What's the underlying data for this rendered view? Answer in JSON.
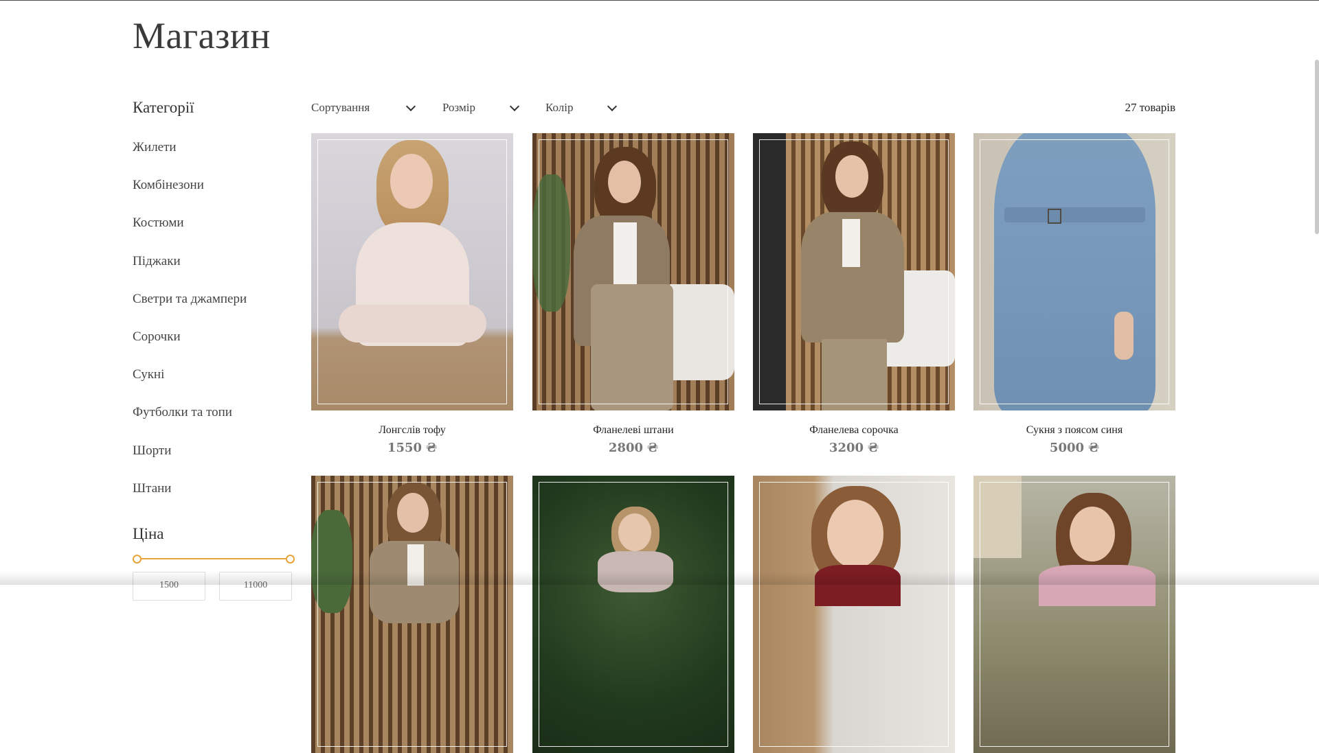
{
  "shop": {
    "title": "Магазин"
  },
  "sidebar": {
    "categories_heading": "Категорії",
    "categories": [
      "Жилети",
      "Комбінезони",
      "Костюми",
      "Піджаки",
      "Светри та джампери",
      "Сорочки",
      "Сукні",
      "Футболки та топи",
      "Шорти",
      "Штани"
    ],
    "price_heading": "Ціна",
    "price_from": "1500",
    "price_to": "11000",
    "accent_color": "#e8a33a"
  },
  "filters": {
    "sort_label": "Сортування",
    "size_label": "Розмір",
    "color_label": "Колір",
    "count_label": "27 товарів"
  },
  "products": [
    {
      "name": "Лонгслів тофу",
      "price": "1550 ₴"
    },
    {
      "name": "Фланелеві штани",
      "price": "2800 ₴"
    },
    {
      "name": "Фланелева сорочка",
      "price": "3200 ₴"
    },
    {
      "name": "Сукня з поясом синя",
      "price": "5000 ₴"
    },
    {
      "name": "",
      "price": ""
    },
    {
      "name": "",
      "price": ""
    },
    {
      "name": "",
      "price": ""
    },
    {
      "name": "",
      "price": ""
    }
  ]
}
